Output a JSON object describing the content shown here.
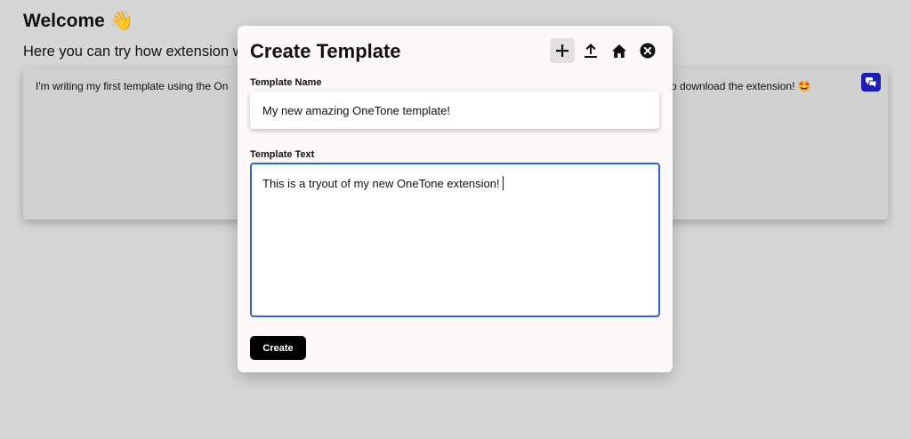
{
  "page": {
    "title": "Welcome 👋",
    "subtitle": "Here you can try how extension w",
    "editor_text": "I'm writing my first template using the On",
    "editor_text_tail": "o download the extension! 🤩",
    "extension_icon": "chat-bubbles-icon",
    "extension_color": "#1b1fb0"
  },
  "modal": {
    "title": "Create Template",
    "toolbar": [
      {
        "name": "add-icon",
        "active": true
      },
      {
        "name": "upload-icon",
        "active": false
      },
      {
        "name": "home-icon",
        "active": false
      },
      {
        "name": "close-icon",
        "active": false
      }
    ],
    "name_label": "Template Name",
    "name_value": "My new amazing OneTone template!",
    "text_label": "Template Text",
    "text_value": "This is a tryout of my new OneTone extension!",
    "create_label": "Create",
    "focus_color": "#2f64c8"
  }
}
